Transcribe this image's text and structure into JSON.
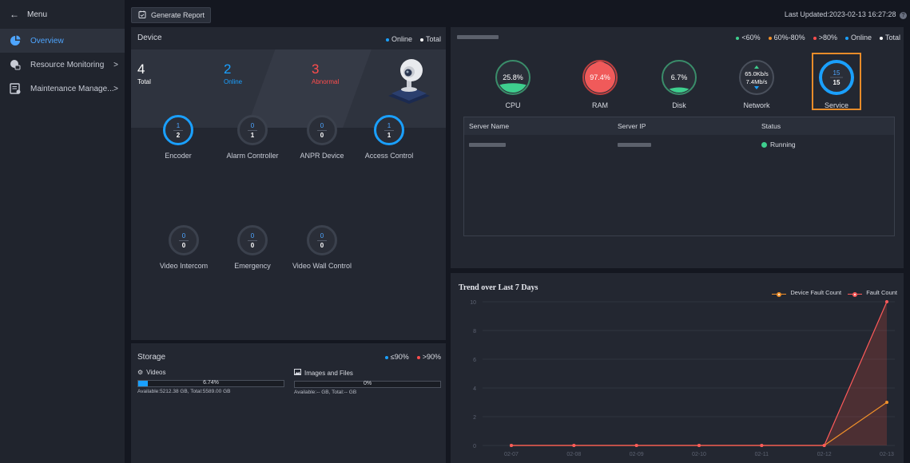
{
  "sidebar": {
    "menu_label": "Menu",
    "items": [
      {
        "label": "Overview"
      },
      {
        "label": "Resource Monitoring"
      },
      {
        "label": "Maintenance Manage..."
      }
    ]
  },
  "topbar": {
    "generate_report_label": "Generate Report",
    "last_updated": "Last Updated:2023-02-13 16:27:28"
  },
  "device": {
    "title": "Device",
    "legend": {
      "online": "Online",
      "total": "Total"
    },
    "stats": {
      "total": {
        "value": "4",
        "label": "Total"
      },
      "online": {
        "value": "2",
        "label": "Online"
      },
      "abnormal": {
        "value": "3",
        "label": "Abnormal"
      }
    },
    "devices": [
      {
        "name": "Encoder",
        "online": "1",
        "total": "2"
      },
      {
        "name": "Alarm Controller",
        "online": "0",
        "total": "1"
      },
      {
        "name": "ANPR Device",
        "online": "0",
        "total": "0"
      },
      {
        "name": "Access Control",
        "online": "1",
        "total": "1"
      },
      {
        "name": "Video Intercom",
        "online": "0",
        "total": "0"
      },
      {
        "name": "Emergency",
        "online": "0",
        "total": "0"
      },
      {
        "name": "Video Wall Control",
        "online": "0",
        "total": "0"
      }
    ]
  },
  "storage": {
    "title": "Storage",
    "legend": {
      "low": "≤90%",
      "high": ">90%"
    },
    "videos": {
      "label": "Videos",
      "percent_text": "6.74%",
      "fraction": 0.0674,
      "available": "Available:5212.38 GB, Total:5589.00 GB"
    },
    "images": {
      "label": "Images and Files",
      "percent_text": "0%",
      "fraction": 0,
      "available": "Available:-- GB, Total:-- GB"
    }
  },
  "server": {
    "legend": {
      "lt60": "<60%",
      "mid": "60%-80%",
      "gt80": ">80%",
      "online": "Online",
      "total": "Total"
    },
    "gauges": {
      "cpu": {
        "label": "CPU",
        "value": "25.8%",
        "fraction": 0.258
      },
      "ram": {
        "label": "RAM",
        "value": "97.4%",
        "fraction": 0.974
      },
      "disk": {
        "label": "Disk",
        "value": "6.7%",
        "fraction": 0.067
      },
      "network": {
        "label": "Network",
        "up": "65.0Kb/s",
        "down": "7.4Mb/s"
      },
      "service": {
        "label": "Service",
        "online": "15",
        "total": "15"
      }
    },
    "table": {
      "columns": [
        "Server Name",
        "Server IP",
        "Status"
      ],
      "rows": [
        {
          "status": "Running"
        }
      ]
    }
  },
  "trend": {
    "title": "Trend over Last 7 Days",
    "legend": {
      "device_fault": "Device Fault Count",
      "fault": "Fault Count"
    },
    "colors": {
      "device_fault": "#f0902a",
      "fault": "#ff5a5a"
    }
  },
  "chart_data": {
    "type": "line",
    "title": "Trend over Last 7 Days",
    "categories": [
      "02-07",
      "02-08",
      "02-09",
      "02-10",
      "02-11",
      "02-12",
      "02-13"
    ],
    "series": [
      {
        "name": "Device Fault Count",
        "values": [
          0,
          0,
          0,
          0,
          0,
          0,
          3
        ]
      },
      {
        "name": "Fault Count",
        "values": [
          0,
          0,
          0,
          0,
          0,
          0,
          10
        ]
      }
    ],
    "ylim": [
      0,
      10
    ],
    "yticks": [
      "0",
      "2",
      "4",
      "6",
      "8",
      "10"
    ],
    "grid": true,
    "legend_position": "top-right"
  }
}
